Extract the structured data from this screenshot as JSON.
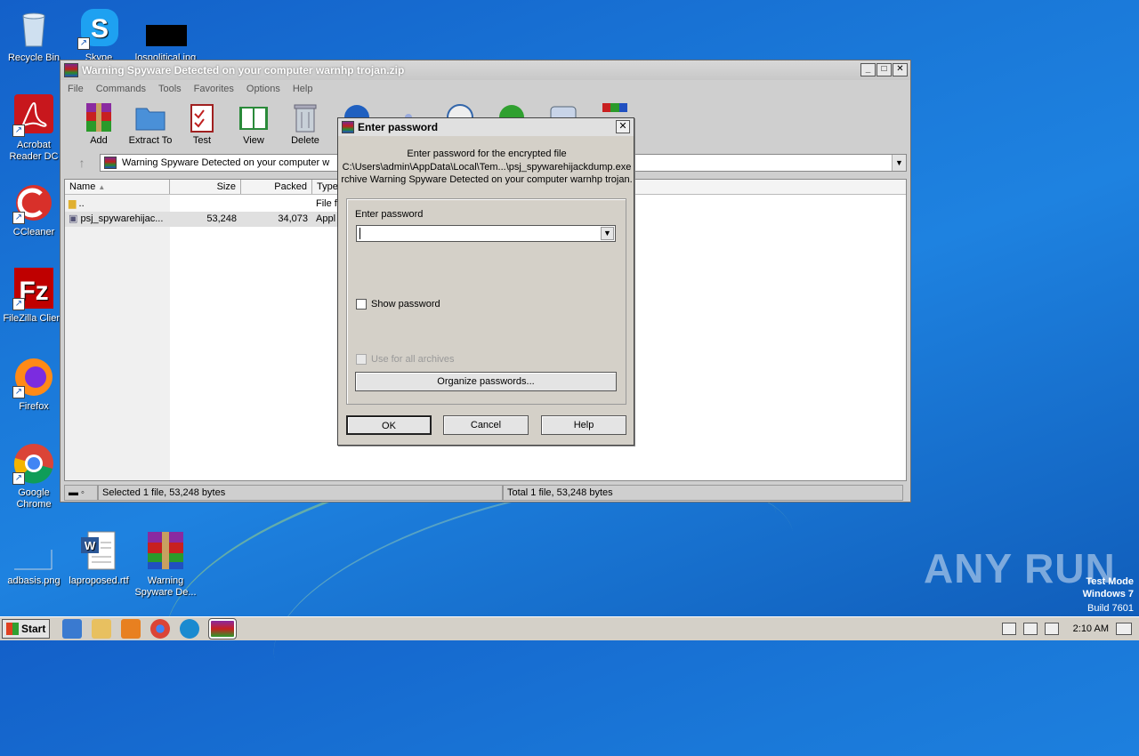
{
  "desktop": {
    "icons": [
      {
        "label": "Recycle Bin",
        "icon": "recycle-bin-icon"
      },
      {
        "label": "Skype",
        "icon": "skype-icon"
      },
      {
        "label": "lospolitical.jpg",
        "icon": "image-file-icon"
      },
      {
        "label": "Acrobat Reader DC",
        "icon": "acrobat-icon"
      },
      {
        "label": "CCleaner",
        "icon": "ccleaner-icon"
      },
      {
        "label": "FileZilla Client",
        "icon": "filezilla-icon"
      },
      {
        "label": "Firefox",
        "icon": "firefox-icon"
      },
      {
        "label": "Google Chrome",
        "icon": "chrome-icon"
      },
      {
        "label": "adbasis.png",
        "icon": "image-file-icon"
      },
      {
        "label": "laproposed.rtf",
        "icon": "word-doc-icon"
      },
      {
        "label": "Warning Spyware De...",
        "icon": "winrar-archive-icon"
      }
    ],
    "watermark": {
      "brand": "ANY RUN",
      "mode": "Test Mode",
      "os": "Windows 7",
      "build": "Build 7601"
    }
  },
  "window": {
    "title": "Warning Spyware Detected on your computer warnhp trojan.zip",
    "menu": [
      "File",
      "Commands",
      "Tools",
      "Favorites",
      "Options",
      "Help"
    ],
    "toolbar": [
      {
        "label": "Add",
        "icon": "add-archive-icon"
      },
      {
        "label": "Extract To",
        "icon": "extract-folder-icon"
      },
      {
        "label": "Test",
        "icon": "test-clipboard-icon"
      },
      {
        "label": "View",
        "icon": "view-book-icon"
      },
      {
        "label": "Delete",
        "icon": "trash-icon"
      }
    ],
    "address": "Warning Spyware Detected on your computer w",
    "columns": [
      "Name",
      "Size",
      "Packed",
      "Type"
    ],
    "files": [
      {
        "name": "..",
        "size": "",
        "packed": "",
        "type": "File f"
      },
      {
        "name": "psj_spywarehijac...",
        "size": "53,248",
        "packed": "34,073",
        "type": "Appl"
      }
    ],
    "status_left": "Selected 1 file, 53,248 bytes",
    "status_right": "Total 1 file, 53,248 bytes"
  },
  "dialog": {
    "title": "Enter password",
    "line1": "Enter password for the encrypted file",
    "line2": "C:\\Users\\admin\\AppData\\Local\\Tem...\\psj_spywarehijackdump.exe",
    "line3": "rchive Warning Spyware Detected on your computer warnhp trojan.",
    "password_label": "Enter password",
    "password_value": "",
    "show_password_label": "Show password",
    "use_all_label": "Use for all archives",
    "organize_label": "Organize passwords...",
    "ok_label": "OK",
    "cancel_label": "Cancel",
    "help_label": "Help"
  },
  "taskbar": {
    "start_label": "Start",
    "time": "2:10 AM"
  }
}
